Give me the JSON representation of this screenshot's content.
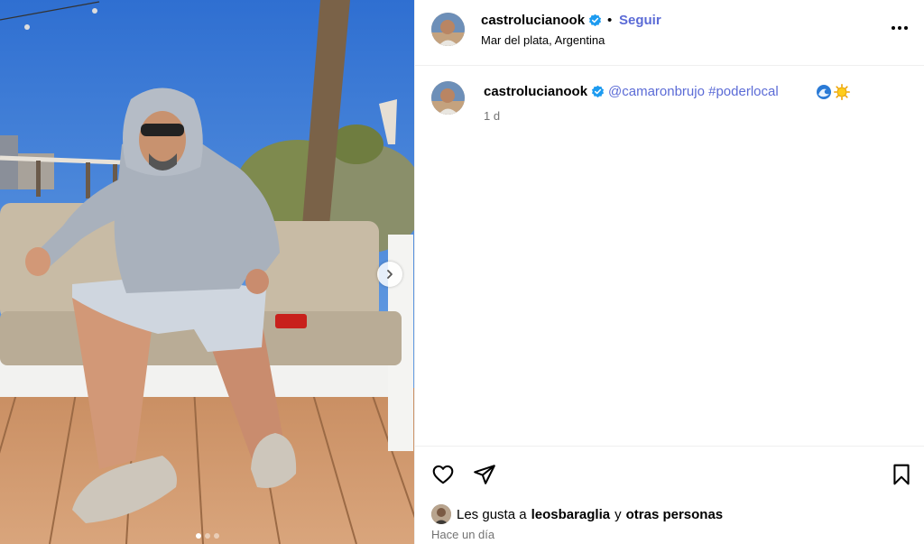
{
  "post": {
    "author": "castrolucianook",
    "follow_label": "Seguir",
    "bullet": "•",
    "location": "Mar del plata, Argentina"
  },
  "caption": {
    "author": "castrolucianook",
    "mention": "@camaronbrujo",
    "hashtag": "#poderlocal",
    "emojis": [
      "wave-emoji",
      "sun-emoji"
    ],
    "time_ago": "1 d"
  },
  "footer": {
    "likes_prefix": "Les gusta a",
    "liker": "leosbaraglia",
    "likes_connector": "y",
    "likes_others": "otras personas",
    "posted_time": "Hace un día"
  },
  "carousel": {
    "total_slides": 3,
    "active_slide": 1
  },
  "colors": {
    "link": "#5b6bd6",
    "verified": "#1d9bf0",
    "muted_text": "#737373",
    "divider": "#efefef"
  },
  "icons": [
    "verified-badge-icon",
    "more-options-icon",
    "heart-icon",
    "share-icon",
    "bookmark-icon",
    "chevron-right-icon"
  ]
}
